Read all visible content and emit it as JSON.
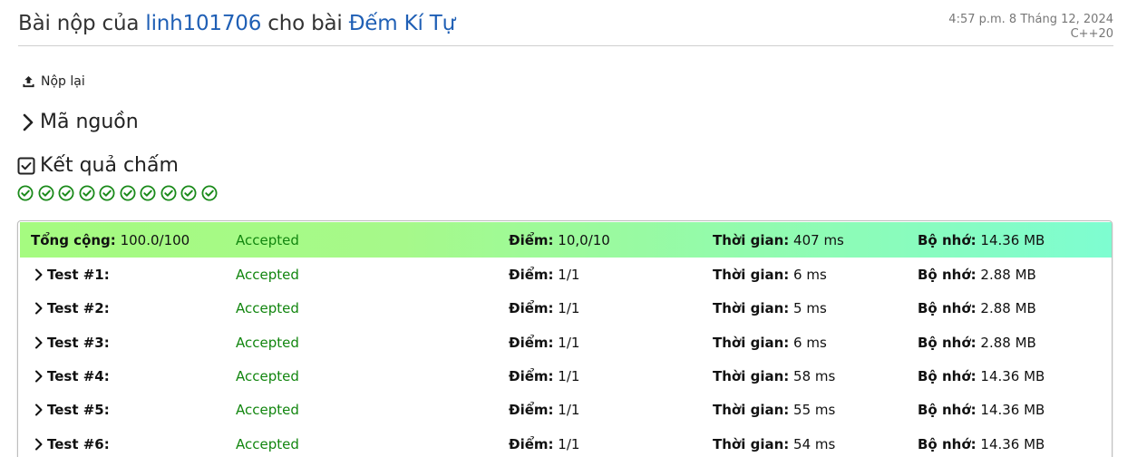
{
  "header": {
    "title_prefix": "Bài nộp của",
    "user": "linh101706",
    "title_mid": "cho bài",
    "problem": "Đếm Kí Tự",
    "date": "4:57 p.m. 8 Tháng 12, 2024",
    "language": "C++20"
  },
  "actions": {
    "resubmit": "Nộp lại",
    "source": "Mã nguồn",
    "results": "Kết quả chấm"
  },
  "labels": {
    "total": "Tổng cộng:",
    "score": "Điểm:",
    "time": "Thời gian:",
    "memory": "Bộ nhớ:"
  },
  "total": {
    "points": "100.0/100",
    "status": "Accepted",
    "score": "10,0/10",
    "time": "407 ms",
    "memory": "14.36 MB"
  },
  "tests": [
    {
      "name": "Test #1:",
      "status": "Accepted",
      "score": "1/1",
      "time": "6 ms",
      "memory": "2.88 MB"
    },
    {
      "name": "Test #2:",
      "status": "Accepted",
      "score": "1/1",
      "time": "5 ms",
      "memory": "2.88 MB"
    },
    {
      "name": "Test #3:",
      "status": "Accepted",
      "score": "1/1",
      "time": "6 ms",
      "memory": "2.88 MB"
    },
    {
      "name": "Test #4:",
      "status": "Accepted",
      "score": "1/1",
      "time": "58 ms",
      "memory": "14.36 MB"
    },
    {
      "name": "Test #5:",
      "status": "Accepted",
      "score": "1/1",
      "time": "55 ms",
      "memory": "14.36 MB"
    },
    {
      "name": "Test #6:",
      "status": "Accepted",
      "score": "1/1",
      "time": "54 ms",
      "memory": "14.36 MB"
    }
  ],
  "case_icons": [
    "check-circle-icon",
    "check-circle-icon",
    "check-circle-icon",
    "check-circle-icon",
    "check-circle-icon",
    "check-circle-icon",
    "check-circle-icon",
    "check-circle-icon",
    "check-circle-icon",
    "check-circle-icon"
  ],
  "colors": {
    "link": "#1f5fb5",
    "accepted": "#12860f",
    "check": "#1a8a1a"
  }
}
